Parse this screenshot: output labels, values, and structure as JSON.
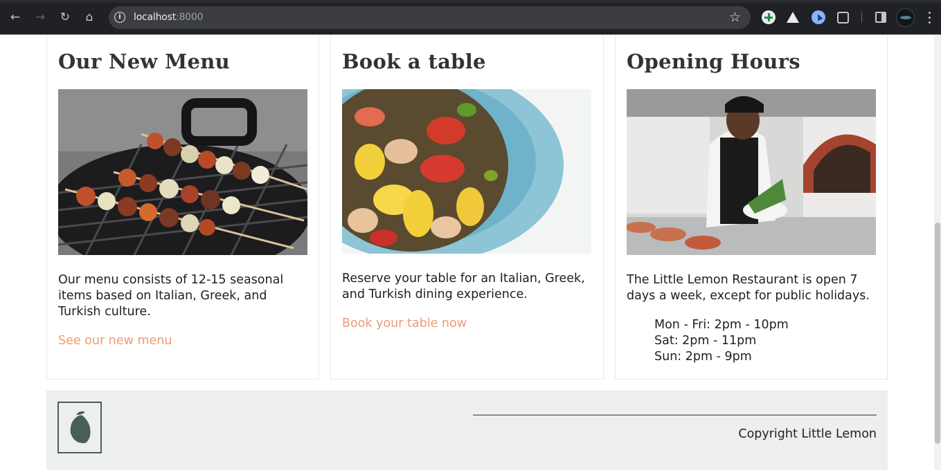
{
  "browser": {
    "url_host": "localhost",
    "url_port": ":8000",
    "icons": [
      "back-arrow-icon",
      "forward-arrow-icon",
      "reload-icon",
      "home-icon",
      "site-info-icon",
      "bookmark-star-icon",
      "extension-icons",
      "side-panel-icon",
      "profile-avatar",
      "more-menu-icon"
    ]
  },
  "cards": [
    {
      "title": "Our New Menu",
      "image": "grilled-skewers-photo",
      "description": "Our menu consists of 12-15 seasonal items based on Italian, Greek, and Turkish culture.",
      "link": "See our new menu"
    },
    {
      "title": "Book a table",
      "image": "salad-plate-photo",
      "description": "Reserve your table for an Italian, Greek, and Turkish dining experience.",
      "link": "Book your table now"
    },
    {
      "title": "Opening Hours",
      "image": "chef-in-kitchen-photo",
      "description": "The Little Lemon Restaurant is open 7 days a week, except for public holidays.",
      "hours": [
        "Mon - Fri: 2pm - 10pm",
        "Sat: 2pm - 11pm",
        "Sun: 2pm - 9pm"
      ]
    }
  ],
  "footer": {
    "copyright": "Copyright Little Lemon",
    "logo_icon": "lemon-logo-icon"
  },
  "colors": {
    "accent_link": "#ec9b76",
    "footer_bg": "#edefee",
    "logo_green": "#495e57",
    "heading": "#333333"
  }
}
